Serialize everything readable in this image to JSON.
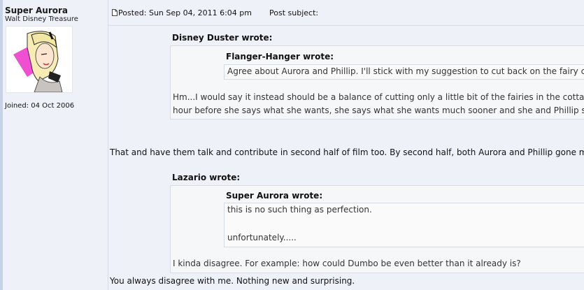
{
  "profile": {
    "username": "Super Aurora",
    "rank": "Walt Disney Treasure",
    "joined": "Joined: 04 Oct 2006"
  },
  "post": {
    "posted": "Posted: Sun Sep 04, 2011 6:04 pm",
    "subject_label": "Post subject:",
    "quote1": {
      "author": "Disney Duster wrote:",
      "nested": {
        "author": "Flanger-Hanger wrote:",
        "text": "Agree about Aurora and Phillip. I'll stick with my suggestion to cut back on the fairy cotta"
      },
      "lines": [
        "Hm...I would say it instead should be a balance of cutting only a little bit of the fairies in the cottage stu",
        "hour before she says what she wants, she says what she wants much sooner and she and Phillip spenc"
      ]
    },
    "reply1": "That and have them talk and contribute in second half of film too. By second half, both Aurora and Phillip gone mute.",
    "quote2": {
      "author": "Lazario wrote:",
      "nested": {
        "author": "Super Aurora wrote:",
        "line1": "this is no such thing as perfection.",
        "line2": "unfortunately....."
      },
      "text": "I kinda disagree. For example: how could Dumbo be even better than it already is?"
    },
    "reply2": "You always disagree with me. Nothing new and surprising."
  },
  "icons": {
    "post_icon": "post-page-icon"
  },
  "colors": {
    "background": "#eef1f7",
    "quote_bg": "#f6f7f9",
    "border": "#d6dbe4"
  }
}
